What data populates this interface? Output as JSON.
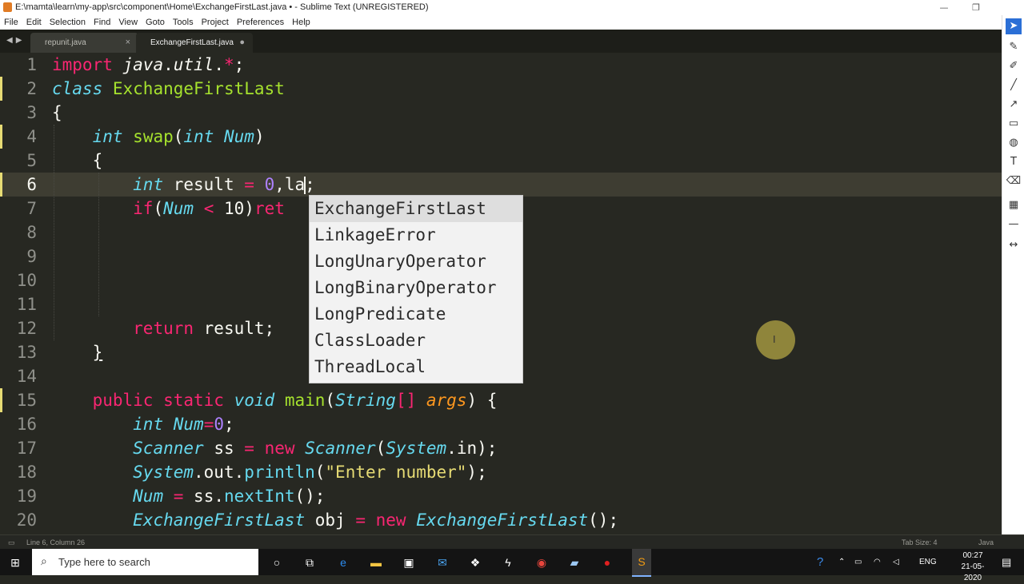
{
  "window": {
    "title": "E:\\mamta\\learn\\my-app\\src\\component\\Home\\ExchangeFirstLast.java • - Sublime Text (UNREGISTERED)"
  },
  "menu": [
    "File",
    "Edit",
    "Selection",
    "Find",
    "View",
    "Goto",
    "Tools",
    "Project",
    "Preferences",
    "Help"
  ],
  "tabs": [
    {
      "label": "repunit.java",
      "active": false,
      "close_glyph": "×"
    },
    {
      "label": "ExchangeFirstLast.java",
      "active": true,
      "close_glyph": "●"
    }
  ],
  "editor": {
    "line_numbers": [
      "1",
      "2",
      "3",
      "4",
      "5",
      "6",
      "7",
      "8",
      "9",
      "10",
      "11",
      "12",
      "13",
      "14",
      "15",
      "16",
      "17",
      "18",
      "19",
      "20"
    ]
  },
  "autocomplete": {
    "items": [
      "ExchangeFirstLast",
      "LinkageError",
      "LongUnaryOperator",
      "LongBinaryOperator",
      "LongPredicate",
      "ClassLoader",
      "ThreadLocal"
    ],
    "selected_index": 0
  },
  "status": {
    "position": "Line 6, Column 26",
    "tab_size": "Tab Size: 4",
    "syntax": "Java"
  },
  "taskbar": {
    "search_placeholder": "Type here to search",
    "language": "ENG",
    "time": "00:27",
    "date": "21-05-2020"
  },
  "colors": {
    "editor_bg": "#272822",
    "keyword": "#f92672",
    "storage_type": "#66d9ef",
    "class_name": "#a6e22e",
    "number": "#ae81ff",
    "string": "#e6db74",
    "parameter": "#fd971f",
    "accent": "#2b6fd6"
  }
}
